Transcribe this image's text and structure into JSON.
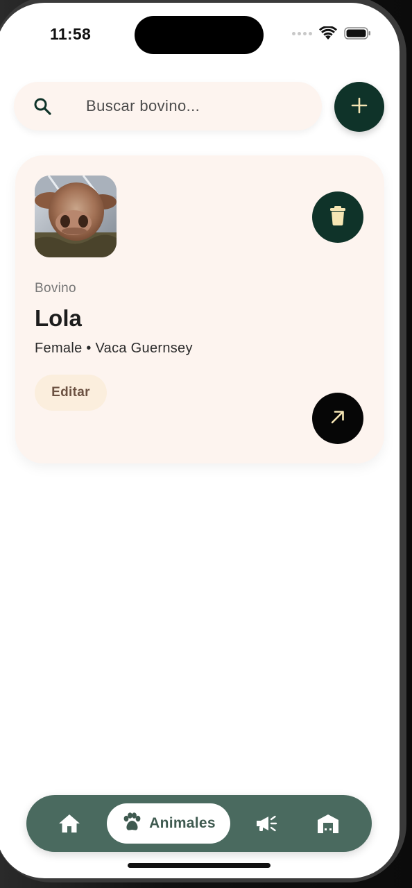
{
  "status_bar": {
    "time": "11:58"
  },
  "search": {
    "placeholder": "Buscar bovino..."
  },
  "animal_card": {
    "species": "Bovino",
    "name": "Lola",
    "details": "Female • Vaca Guernsey",
    "edit_label": "Editar"
  },
  "bottom_nav": {
    "active_label": "Animales",
    "items": [
      "home-icon",
      "paw-icon",
      "megaphone-icon",
      "barn-icon"
    ]
  },
  "icons": {
    "search": "search-icon",
    "add": "plus-icon",
    "delete": "trash-icon",
    "open": "arrow-up-right-icon"
  },
  "colors": {
    "primary_dark": "#0f3329",
    "card_bg": "#fdf4ef",
    "nav_bg": "#4a6a5f",
    "accent_icon": "#f6e6b4"
  }
}
